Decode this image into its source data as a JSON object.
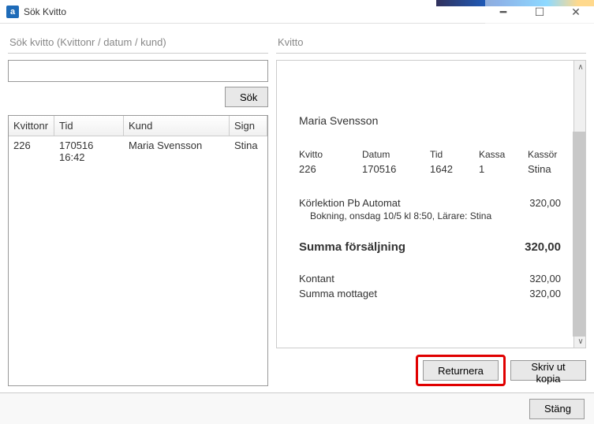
{
  "window": {
    "title": "Sök Kvitto"
  },
  "left": {
    "header": "Sök kvitto (Kvittonr / datum / kund)",
    "search_value": "",
    "search_btn": "Sök",
    "columns": {
      "kvittonr": "Kvittonr",
      "tid": "Tid",
      "kund": "Kund",
      "sign": "Sign"
    },
    "row": {
      "kvittonr": "226",
      "tid": "170516 16:42",
      "kund": "Maria Svensson",
      "sign": "Stina"
    }
  },
  "right": {
    "header": "Kvitto",
    "customer": "Maria Svensson",
    "col_labels": {
      "kvitto": "Kvitto",
      "datum": "Datum",
      "tid": "Tid",
      "kassa": "Kassa",
      "kassor": "Kassör"
    },
    "col_values": {
      "kvitto": "226",
      "datum": "170516",
      "tid": "1642",
      "kassa": "1",
      "kassor": "Stina"
    },
    "item": {
      "name": "Körlektion Pb Automat",
      "price": "320,00",
      "detail": "Bokning, onsdag 10/5 kl 8:50, Lärare: Stina"
    },
    "total_label": "Summa försäljning",
    "total_value": "320,00",
    "payment1_label": "Kontant",
    "payment1_value": "320,00",
    "payment2_label": "Summa mottaget",
    "payment2_value": "320,00",
    "return_btn": "Returnera",
    "print_btn": "Skriv ut kopia"
  },
  "footer": {
    "close_btn": "Stäng"
  }
}
